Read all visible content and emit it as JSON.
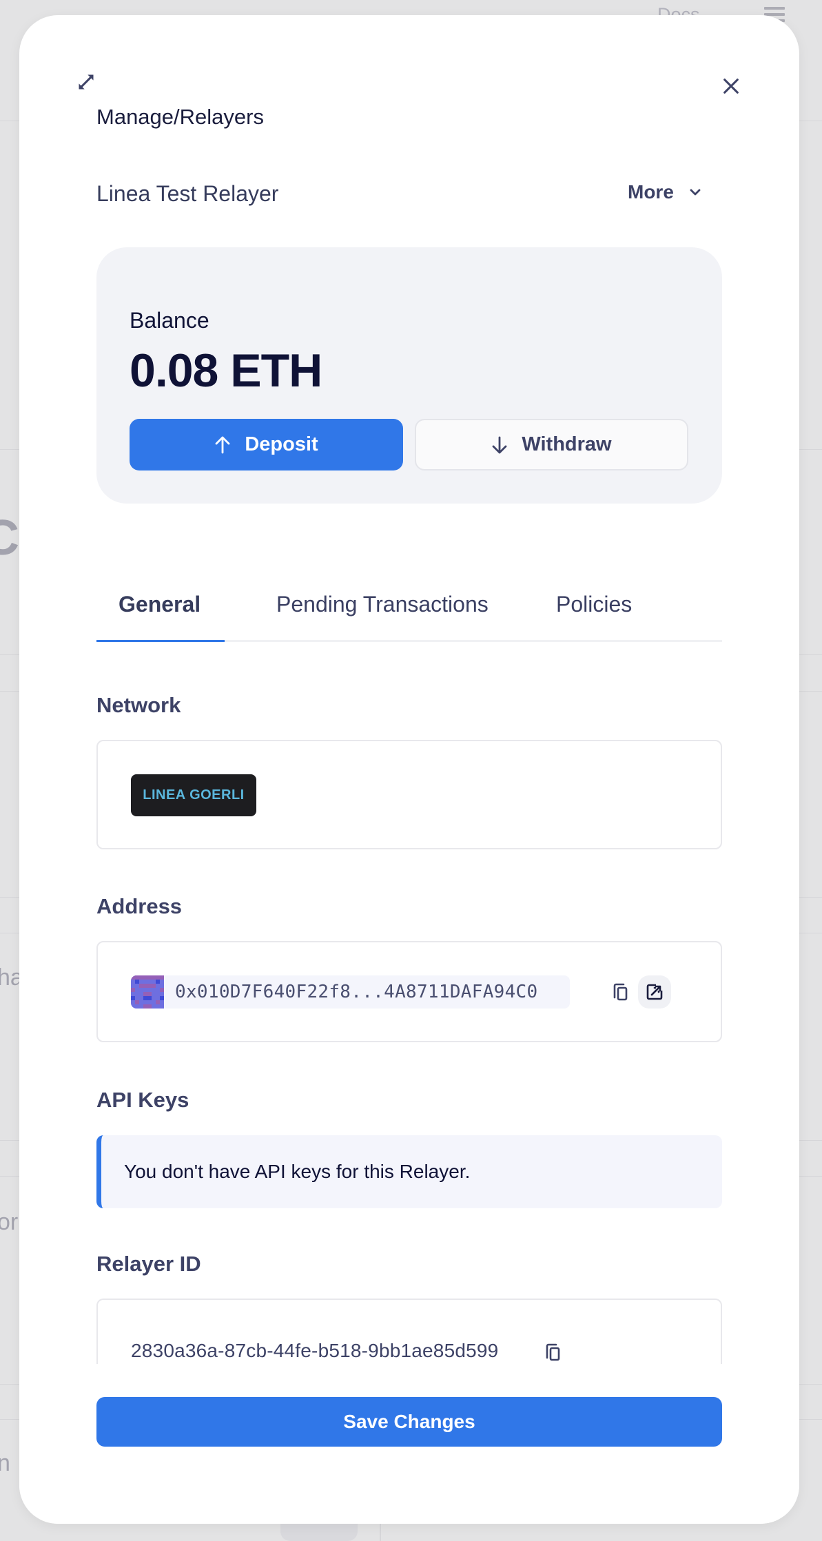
{
  "background": {
    "docs_link": "Docs",
    "fragments": [
      "C",
      "ha",
      "or",
      "n"
    ]
  },
  "modal": {
    "breadcrumb": "Manage/Relayers",
    "relayer_name": "Linea Test Relayer",
    "more_label": "More",
    "balance": {
      "label": "Balance",
      "value": "0.08 ETH",
      "deposit_label": "Deposit",
      "withdraw_label": "Withdraw"
    },
    "tabs": [
      {
        "label": "General",
        "active": true
      },
      {
        "label": "Pending Transactions",
        "active": false
      },
      {
        "label": "Policies",
        "active": false
      }
    ],
    "network": {
      "label": "Network",
      "value": "LINEA GOERLI"
    },
    "address": {
      "label": "Address",
      "value": "0x010D7F640F22f8...4A8711DAFA94C0"
    },
    "api_keys": {
      "label": "API Keys",
      "empty_message": "You don't have API keys for this Relayer."
    },
    "relayer_id": {
      "label": "Relayer ID",
      "value": "2830a36a-87cb-44fe-b518-9bb1ae85d599"
    },
    "save_label": "Save Changes"
  },
  "colors": {
    "accent": "#3077e8",
    "text_dark": "#0f1236",
    "text_muted": "#3d4266",
    "card_bg": "#f2f3f7",
    "network_chip_bg": "#1d1d20",
    "network_chip_text": "#5ab6dc"
  }
}
